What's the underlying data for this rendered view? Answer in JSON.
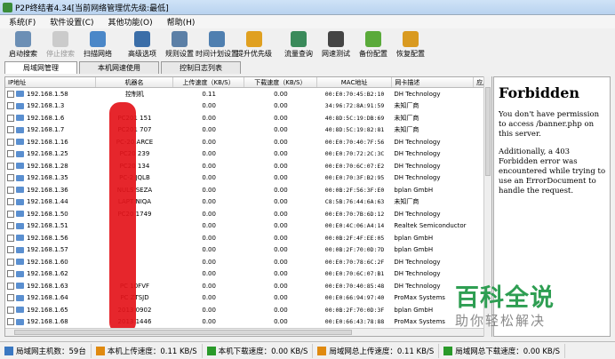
{
  "window": {
    "title": "P2P终结者4.34[当前网络管理优先级:最低]"
  },
  "menu": [
    "系统(F)",
    "软件设置(C)",
    "其他功能(O)",
    "帮助(H)"
  ],
  "toolbar": [
    {
      "label": "启动搜索",
      "icon": "start-search-icon",
      "color": "#6c8fb5",
      "disabled": false
    },
    {
      "label": "停止搜索",
      "icon": "stop-search-icon",
      "color": "#888888",
      "disabled": true
    },
    {
      "label": "扫描网络",
      "icon": "scan-network-icon",
      "color": "#4a87c8",
      "disabled": false
    },
    {
      "label": "高级选项",
      "icon": "advanced-options-icon",
      "color": "#3b6ea8",
      "disabled": false
    },
    {
      "label": "规则设置",
      "icon": "rules-icon",
      "color": "#5b7fa6",
      "disabled": false
    },
    {
      "label": "时间计划设置",
      "icon": "time-plan-icon",
      "color": "#4f7fb0",
      "disabled": false
    },
    {
      "label": "提升优先级",
      "icon": "priority-icon",
      "color": "#e0a020",
      "disabled": false
    },
    {
      "label": "流量查询",
      "icon": "traffic-query-icon",
      "color": "#3a8a5a",
      "disabled": false
    },
    {
      "label": "网速测试",
      "icon": "speed-test-icon",
      "color": "#444444",
      "disabled": false
    },
    {
      "label": "备份配置",
      "icon": "backup-config-icon",
      "color": "#5aaa3a",
      "disabled": false
    },
    {
      "label": "恢复配置",
      "icon": "restore-config-icon",
      "color": "#d99a20",
      "disabled": false
    }
  ],
  "tabs": [
    "局域网管理",
    "本机网速使用",
    "控制日志列表"
  ],
  "grid": {
    "headers": [
      "IP地址",
      "机器名",
      "上传速度（KB/S）",
      "下载速度（KB/S）",
      "MAC地址",
      "网卡描述",
      "应用"
    ],
    "rows": [
      {
        "ip": "192.168.1.58",
        "name": "控制机",
        "up": "0.11",
        "down": "0.00",
        "mac": "00:E0:70:45:B2:10",
        "nic": "DH Technology"
      },
      {
        "ip": "192.168.1.3",
        "name": "",
        "up": "0.00",
        "down": "0.00",
        "mac": "34:96:72:8A:91:59",
        "nic": "未知厂商"
      },
      {
        "ip": "192.168.1.6",
        "name": "PC201     151",
        "up": "0.00",
        "down": "0.00",
        "mac": "40:8D:5C:19:DB:69",
        "nic": "未知厂商"
      },
      {
        "ip": "192.168.1.7",
        "name": "PC201     707",
        "up": "0.00",
        "down": "0.00",
        "mac": "40:8D:5C:19:82:81",
        "nic": "未知厂商"
      },
      {
        "ip": "192.168.1.16",
        "name": "PC-20     ARCE",
        "up": "0.00",
        "down": "0.00",
        "mac": "00:E0:70:40:7F:56",
        "nic": "DH Technology"
      },
      {
        "ip": "192.168.1.25",
        "name": "PC20     239",
        "up": "0.00",
        "down": "0.00",
        "mac": "00:E0:70:72:2C:3C",
        "nic": "DH Technology"
      },
      {
        "ip": "192.168.1.28",
        "name": "PC20     134",
        "up": "0.00",
        "down": "0.00",
        "mac": "00:E0:70:6C:07:E2",
        "nic": "DH Technology"
      },
      {
        "ip": "192.168.1.35",
        "name": "PC-2     JQLB",
        "up": "0.00",
        "down": "0.00",
        "mac": "00:E0:70:3F:B2:95",
        "nic": "DH Technology"
      },
      {
        "ip": "192.168.1.36",
        "name": "NULS     SEZA",
        "up": "0.00",
        "down": "0.00",
        "mac": "00:0B:2F:56:3F:E0",
        "nic": "bplan GmbH"
      },
      {
        "ip": "192.168.1.44",
        "name": "LAPT     NIQA",
        "up": "0.00",
        "down": "0.00",
        "mac": "C8:5B:76:44:6A:63",
        "nic": "未知厂商"
      },
      {
        "ip": "192.168.1.50",
        "name": "PC20     1749",
        "up": "0.00",
        "down": "0.00",
        "mac": "00:E0:70:7B:6D:12",
        "nic": "DH Technology"
      },
      {
        "ip": "192.168.1.51",
        "name": "",
        "up": "0.00",
        "down": "0.00",
        "mac": "00:E0:4C:06:A4:14",
        "nic": "Realtek Semiconductor"
      },
      {
        "ip": "192.168.1.56",
        "name": "",
        "up": "0.00",
        "down": "0.00",
        "mac": "00:0B:2F:4F:EE:05",
        "nic": "bplan GmbH"
      },
      {
        "ip": "192.168.1.57",
        "name": "",
        "up": "0.00",
        "down": "0.00",
        "mac": "00:0B:2F:70:0D:7D",
        "nic": "bplan GmbH"
      },
      {
        "ip": "192.168.1.60",
        "name": "",
        "up": "0.00",
        "down": "0.00",
        "mac": "00:E0:70:78:6C:2F",
        "nic": "DH Technology"
      },
      {
        "ip": "192.168.1.62",
        "name": "",
        "up": "0.00",
        "down": "0.00",
        "mac": "00:E0:70:6C:07:B1",
        "nic": "DH Technology"
      },
      {
        "ip": "192.168.1.63",
        "name": "PC     10FVF",
        "up": "0.00",
        "down": "0.00",
        "mac": "00:E0:70:40:85:48",
        "nic": "DH Technology"
      },
      {
        "ip": "192.168.1.64",
        "name": "PC     ZTSJD",
        "up": "0.00",
        "down": "0.00",
        "mac": "00:E0:66:94:97:40",
        "nic": "ProMax Systems"
      },
      {
        "ip": "192.168.1.65",
        "name": "2013     0902",
        "up": "0.00",
        "down": "0.00",
        "mac": "00:0B:2F:70:0D:3F",
        "nic": "bplan GmbH"
      },
      {
        "ip": "192.168.1.68",
        "name": "2013     1446",
        "up": "0.00",
        "down": "0.00",
        "mac": "00:E0:66:43:78:88",
        "nic": "ProMax Systems"
      }
    ]
  },
  "side_panel": {
    "title": "Forbidden",
    "paragraphs": [
      "You don't have permission to access /banner.php on this server.",
      "Additionally, a 403 Forbidden error was encountered while trying to use an ErrorDocument to handle the request."
    ]
  },
  "watermark": {
    "main": "百科全说",
    "sub": "助你轻松解决"
  },
  "status": [
    {
      "text": "局域网主机数：59台",
      "icon": "network-icon",
      "color": "#3a78c2"
    },
    {
      "text": "本机上传速度：0.11 KB/S",
      "icon": "upload-arrow-icon",
      "color": "#e08a10"
    },
    {
      "text": "本机下载速度：0.00 KB/S",
      "icon": "download-arrow-icon",
      "color": "#2a9a2a"
    },
    {
      "text": "局域网总上传速度：0.11 KB/S",
      "icon": "lan-upload-arrow-icon",
      "color": "#e08a10"
    },
    {
      "text": "局域网总下载速度：0.00 KB/S",
      "icon": "lan-download-arrow-icon",
      "color": "#2a9a2a"
    }
  ]
}
